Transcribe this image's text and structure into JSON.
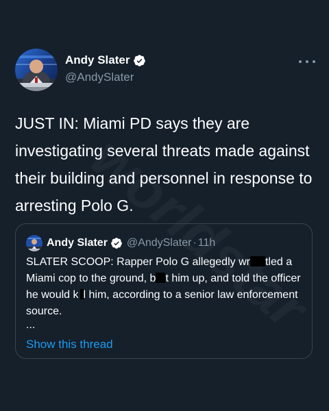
{
  "tweet": {
    "author": {
      "name": "Andy Slater",
      "handle": "@AndySlater",
      "verified": true,
      "avatar": "avatar-news-anchor"
    },
    "more_icon": "more-horizontal-icon",
    "text": "JUST IN: Miami PD says they are investigating several threats made against their building and personnel in response to arresting Polo G."
  },
  "quoted_tweet": {
    "author": {
      "name": "Andy Slater",
      "handle": "@AndySlater",
      "verified": true
    },
    "separator": "·",
    "time": "11h",
    "text_parts": [
      "SLATER SCOOP: Rapper Polo G allegedly wr",
      "tled a Miami cop to the ground, b",
      "t him up, and told the officer he would k",
      "l him, according to a senior law enforcement source."
    ],
    "ellipsis": "...",
    "show_thread": "Show this thread"
  },
  "watermark": "worldstar",
  "colors": {
    "background": "#15202b",
    "text": "#ffffff",
    "secondary": "#8899a6",
    "border": "#38444d",
    "link": "#1d9bf0",
    "verified": "#ffffff"
  }
}
